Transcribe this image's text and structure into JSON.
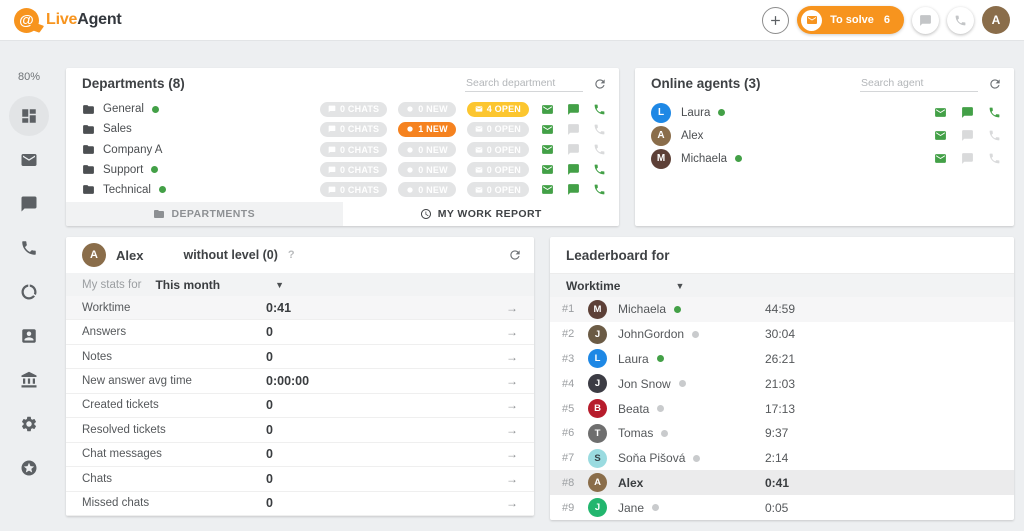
{
  "colors": {
    "accent_orange": "#f7941e",
    "badge_yellow": "#fcc62f",
    "badge_orange": "#f5821f",
    "badge_gray": "#e3e4e5",
    "online_green": "#43a047",
    "page_background": "#edeff1"
  },
  "header": {
    "logo_live": "Live",
    "logo_agent": "Agent",
    "to_solve_label": "To solve",
    "to_solve_count": "6",
    "avatar_initial": "A"
  },
  "sidebar": {
    "usage_percent": "80%",
    "items": [
      {
        "icon": "dashboard-icon",
        "active": true
      },
      {
        "icon": "mail-icon"
      },
      {
        "icon": "chat-icon"
      },
      {
        "icon": "phone-icon"
      },
      {
        "icon": "ring-icon"
      },
      {
        "icon": "contacts-icon"
      },
      {
        "icon": "bank-icon"
      },
      {
        "icon": "gear-icon"
      },
      {
        "icon": "star-circle-icon"
      }
    ]
  },
  "departments": {
    "title": "Departments (8)",
    "search_placeholder": "Search department",
    "rows": [
      {
        "name": "General",
        "online": true,
        "chats": "0 CHATS",
        "new": "0 NEW",
        "open": "4 OPEN",
        "open_state": "yellow",
        "new_state": "gray",
        "mail": true,
        "chat": true,
        "call": true
      },
      {
        "name": "Sales",
        "online": false,
        "chats": "0 CHATS",
        "new": "1 NEW",
        "open": "0 OPEN",
        "open_state": "gray",
        "new_state": "orange",
        "mail": true,
        "chat": false,
        "call": false
      },
      {
        "name": "Company A",
        "online": false,
        "chats": "0 CHATS",
        "new": "0 NEW",
        "open": "0 OPEN",
        "open_state": "gray",
        "new_state": "gray",
        "mail": true,
        "chat": false,
        "call": false
      },
      {
        "name": "Support",
        "online": true,
        "chats": "0 CHATS",
        "new": "0 NEW",
        "open": "0 OPEN",
        "open_state": "gray",
        "new_state": "gray",
        "mail": true,
        "chat": true,
        "call": true
      },
      {
        "name": "Technical",
        "online": true,
        "chats": "0 CHATS",
        "new": "0 NEW",
        "open": "0 OPEN",
        "open_state": "gray",
        "new_state": "gray",
        "mail": true,
        "chat": true,
        "call": true
      }
    ],
    "tabs": [
      {
        "label": "DEPARTMENTS",
        "active": true
      },
      {
        "label": "MY WORK REPORT",
        "active": false
      }
    ]
  },
  "agents": {
    "title": "Online agents (3)",
    "search_placeholder": "Search agent",
    "rows": [
      {
        "name": "Laura",
        "initial": "L",
        "avatar_color": "#1e88e5",
        "online": true,
        "mail": true,
        "chat": true,
        "call": true
      },
      {
        "name": "Alex",
        "initial": "A",
        "avatar_color": "#8a6d4a",
        "online": false,
        "mail": true,
        "chat": false,
        "call": false
      },
      {
        "name": "Michaela",
        "initial": "M",
        "avatar_color": "#5d4037",
        "online": true,
        "mail": true,
        "chat": false,
        "call": false
      }
    ]
  },
  "my_stats": {
    "agent_name": "Alex",
    "avatar_initial": "A",
    "avatar_color": "#8a6d4a",
    "level_label": "without level (0)",
    "help": "?",
    "period_label": "My stats for",
    "period_value": "This month",
    "rows": [
      {
        "label": "Worktime",
        "value": "0:41",
        "highlight": true
      },
      {
        "label": "Answers",
        "value": "0"
      },
      {
        "label": "Notes",
        "value": "0"
      },
      {
        "label": "New answer avg time",
        "value": "0:00:00"
      },
      {
        "label": "Created tickets",
        "value": "0"
      },
      {
        "label": "Resolved tickets",
        "value": "0"
      },
      {
        "label": "Chat messages",
        "value": "0"
      },
      {
        "label": "Chats",
        "value": "0"
      },
      {
        "label": "Missed chats",
        "value": "0"
      }
    ]
  },
  "leaderboard": {
    "title": "Leaderboard for",
    "metric": "Worktime",
    "rows": [
      {
        "rank": "#1",
        "name": "Michaela",
        "value": "44:59",
        "initial": "M",
        "avatar_color": "#5d4037",
        "online": true,
        "highlight": true
      },
      {
        "rank": "#2",
        "name": "JohnGordon",
        "value": "30:04",
        "initial": "J",
        "avatar_color": "#6b5b45",
        "online": false
      },
      {
        "rank": "#3",
        "name": "Laura",
        "value": "26:21",
        "initial": "L",
        "avatar_color": "#1e88e5",
        "online": true
      },
      {
        "rank": "#4",
        "name": "Jon Snow",
        "value": "21:03",
        "initial": "J",
        "avatar_color": "#3c3c44",
        "online": false
      },
      {
        "rank": "#5",
        "name": "Beata",
        "value": "17:13",
        "initial": "B",
        "avatar_color": "#b71c2c",
        "online": false
      },
      {
        "rank": "#6",
        "name": "Tomas",
        "value": "9:37",
        "initial": "T",
        "avatar_color": "#6e6e6e",
        "online": false
      },
      {
        "rank": "#7",
        "name": "Soňa Pišová",
        "value": "2:14",
        "initial": "S",
        "avatar_color": "#9adbe0",
        "online": false
      },
      {
        "rank": "#8",
        "name": "Alex",
        "value": "0:41",
        "initial": "A",
        "avatar_color": "#8a6d4a",
        "highlight": true
      },
      {
        "rank": "#9",
        "name": "Jane",
        "value": "0:05",
        "initial": "J",
        "avatar_color": "#22b66e",
        "online": false
      }
    ]
  }
}
